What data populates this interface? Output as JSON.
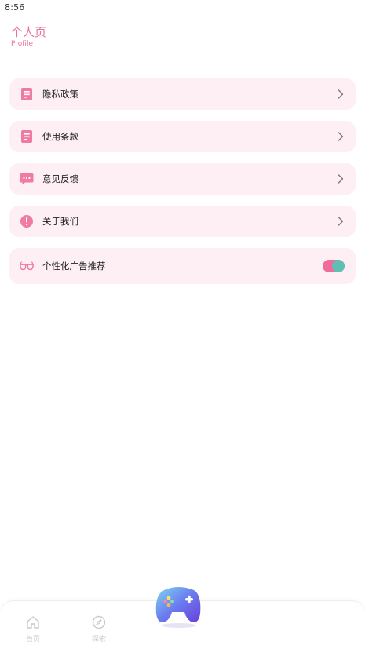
{
  "status_bar": {
    "time": "8:56"
  },
  "header": {
    "title": "个人页",
    "subtitle": "Profile"
  },
  "colors": {
    "accent": "#e8749d",
    "card_bg": "#fdeff4",
    "icon_pink": "#ef7aa2",
    "toggle_on": "#f06b9a",
    "toggle_knob": "#5fbfb2"
  },
  "menu": {
    "items": [
      {
        "label": "隐私政策",
        "icon": "document-icon",
        "control": "chevron"
      },
      {
        "label": "使用条款",
        "icon": "document-icon",
        "control": "chevron"
      },
      {
        "label": "意见反馈",
        "icon": "chat-bubble-icon",
        "control": "chevron"
      },
      {
        "label": "关于我们",
        "icon": "info-circle-icon",
        "control": "chevron"
      },
      {
        "label": "个性化广告推荐",
        "icon": "glasses-icon",
        "control": "toggle",
        "toggle_on": true
      }
    ]
  },
  "bottom_nav": {
    "items": [
      {
        "label": "首页",
        "icon": "home-icon"
      },
      {
        "label": "探索",
        "icon": "compass-icon"
      }
    ],
    "center_button": {
      "icon": "gamepad-icon"
    }
  }
}
